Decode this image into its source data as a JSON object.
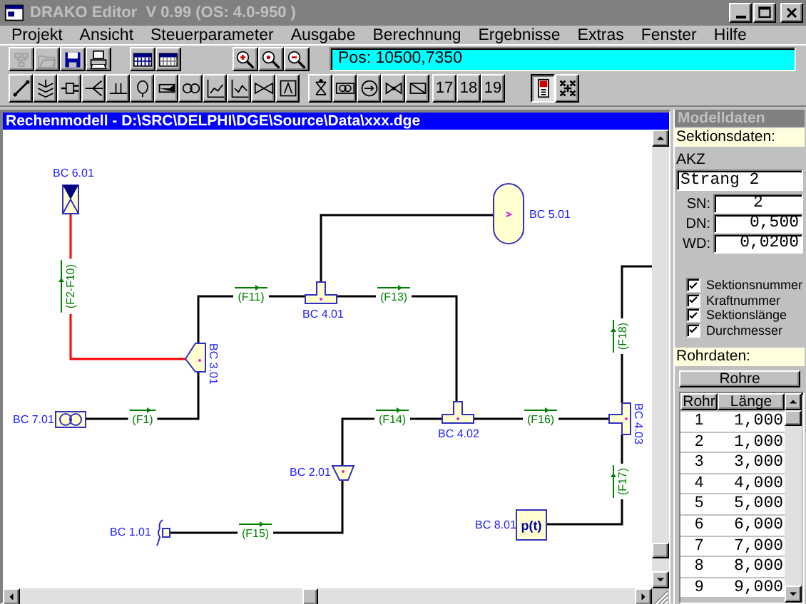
{
  "window": {
    "title": "DRAKO Editor  V 0.99 (OS: 4.0-950 )"
  },
  "menu": [
    "Projekt",
    "Ansicht",
    "Steuerparameter",
    "Ausgabe",
    "Berechnung",
    "Ergebnisse",
    "Extras",
    "Fenster",
    "Hilfe"
  ],
  "toolbar_1": {
    "buttons": [
      {
        "disabled": true
      },
      {
        "disabled": true
      },
      {
        "disabled": false
      },
      {
        "disabled": false
      },
      {
        "disabled": false
      },
      {
        "disabled": false
      },
      {
        "disabled": false
      },
      {
        "disabled": false
      },
      {
        "disabled": false
      }
    ],
    "position": "Pos: 10500,7350"
  },
  "toolbar_2": [
    {
      "kind": "icon",
      "pressed": false
    },
    {
      "kind": "icon",
      "pressed": false
    },
    {
      "kind": "icon",
      "pressed": false
    },
    {
      "kind": "icon",
      "pressed": false
    },
    {
      "kind": "icon",
      "pressed": false
    },
    {
      "kind": "icon",
      "pressed": false
    },
    {
      "kind": "icon",
      "pressed": false
    },
    {
      "kind": "icon",
      "pressed": false
    },
    {
      "kind": "icon",
      "pressed": false
    },
    {
      "kind": "icon",
      "pressed": false
    },
    {
      "kind": "icon",
      "pressed": false
    },
    {
      "kind": "icon",
      "pressed": false
    },
    {
      "kind": "icon",
      "pressed": false
    },
    {
      "kind": "icon",
      "pressed": false
    },
    {
      "kind": "icon",
      "pressed": false
    },
    {
      "kind": "icon",
      "pressed": false
    },
    {
      "kind": "icon",
      "pressed": false
    },
    {
      "kind": "number",
      "label": "17",
      "pressed": false
    },
    {
      "kind": "number",
      "label": "18",
      "pressed": false
    },
    {
      "kind": "number",
      "label": "19",
      "pressed": false
    },
    {
      "kind": "icon",
      "pressed": true
    },
    {
      "kind": "icon",
      "pressed": false
    }
  ],
  "model_window": {
    "title": "Rechenmodell - D:\\SRC\\DELPHI\\DGE\\Source\\Data\\xxx.dge",
    "nodes": [
      {
        "label": "BC 6.01",
        "kind": "valve"
      },
      {
        "label": "BC 3.01",
        "kind": "branch"
      },
      {
        "label": "BC 4.01",
        "kind": "tee"
      },
      {
        "label": "BC 5.01",
        "kind": "tank"
      },
      {
        "label": "BC 7.01",
        "kind": "pump"
      },
      {
        "label": "BC 4.02",
        "kind": "tee"
      },
      {
        "label": "BC 4.03",
        "kind": "tee"
      },
      {
        "label": "BC 2.01",
        "kind": "reducer"
      },
      {
        "label": "BC 1.01",
        "kind": "end"
      },
      {
        "label": "BC 8.01",
        "kind": "pressure",
        "symbol": "p(t)"
      }
    ],
    "pipes": [
      {
        "label": "(F2-F10)",
        "selected": true
      },
      {
        "label": "(F11)",
        "selected": false
      },
      {
        "label": "(F13)",
        "selected": false
      },
      {
        "selected": false
      },
      {
        "label": "(F1)",
        "selected": false
      },
      {
        "label": "(F14)",
        "selected": false
      },
      {
        "label": "(F16)",
        "selected": false
      },
      {
        "label": "(F18)",
        "selected": false
      },
      {
        "label": "(F17)",
        "selected": false
      },
      {
        "label": "(F15)",
        "selected": false
      }
    ]
  },
  "model_data": {
    "title": "Modelldaten",
    "section_heading": "Sektionsdaten:",
    "akz_label": "AKZ",
    "akz_value": "Strang 2",
    "fields": [
      {
        "label": "SN:",
        "value": "2"
      },
      {
        "label": "DN:",
        "value": "0,500"
      },
      {
        "label": "WD:",
        "value": "0,0200"
      }
    ],
    "options": [
      {
        "label": "Sektionsnummer",
        "checked": true
      },
      {
        "label": "Kraftnummer",
        "checked": true
      },
      {
        "label": "Sektionslänge",
        "checked": true
      },
      {
        "label": "Durchmesser",
        "checked": true
      }
    ],
    "pipe_heading": "Rohrdaten:",
    "pipes_button": "Rohre",
    "table": {
      "columns": [
        "Rohr",
        "Länge"
      ],
      "rows": [
        [
          "1",
          "1,000"
        ],
        [
          "2",
          "1,000"
        ],
        [
          "3",
          "3,000"
        ],
        [
          "4",
          "4,000"
        ],
        [
          "5",
          "5,000"
        ],
        [
          "6",
          "6,000"
        ],
        [
          "7",
          "7,000"
        ],
        [
          "8",
          "8,000"
        ],
        [
          "9",
          "9,000"
        ]
      ]
    }
  }
}
